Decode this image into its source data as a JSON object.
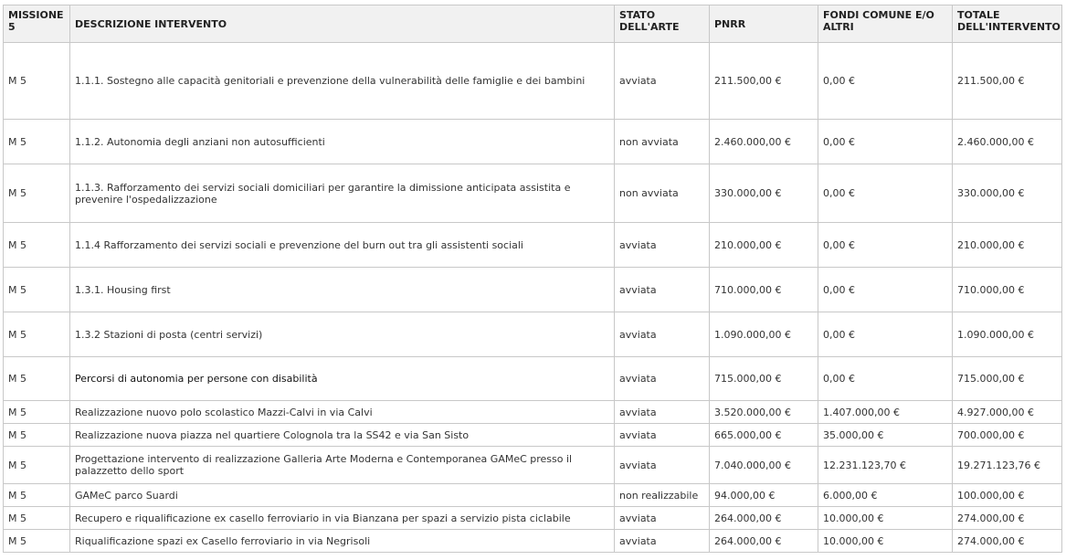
{
  "headers": {
    "missione": "MISSIONE 5",
    "descrizione": "DESCRIZIONE INTERVENTO",
    "stato": "STATO DELL'ARTE",
    "pnrr": "PNRR",
    "fondi": "FONDI COMUNE E/O ALTRI",
    "totale": "TOTALE DELL'INTERVENTO"
  },
  "rows": [
    {
      "missione": "M 5",
      "descrizione": "1.1.1. Sostegno alle capacità genitoriali e prevenzione della vulnerabilità delle famiglie e dei bambini",
      "stato": "avviata",
      "pnrr": "211.500,00 €",
      "fondi": "0,00 €",
      "totale": "211.500,00 €"
    },
    {
      "missione": "M 5",
      "descrizione": "1.1.2. Autonomia degli anziani non autosufficienti",
      "stato": "non avviata",
      "pnrr": "2.460.000,00 €",
      "fondi": "0,00 €",
      "totale": "2.460.000,00 €"
    },
    {
      "missione": "M 5",
      "descrizione": "1.1.3. Rafforzamento dei servizi sociali domiciliari per garantire la dimissione anticipata assistita e prevenire l'ospedalizzazione",
      "stato": "non avviata",
      "pnrr": "330.000,00 €",
      "fondi": "0,00 €",
      "totale": "330.000,00 €"
    },
    {
      "missione": "M 5",
      "descrizione": "1.1.4 Rafforzamento dei servizi sociali e prevenzione del burn out tra gli assistenti sociali",
      "stato": "avviata",
      "pnrr": "210.000,00 €",
      "fondi": "0,00 €",
      "totale": "210.000,00 €"
    },
    {
      "missione": "M 5",
      "descrizione": "1.3.1. Housing first",
      "stato": "avviata",
      "pnrr": "710.000,00 €",
      "fondi": "0,00 €",
      "totale": "710.000,00 €"
    },
    {
      "missione": "M 5",
      "descrizione": "1.3.2 Stazioni di posta (centri servizi)",
      "stato": "avviata",
      "pnrr": "1.090.000,00 €",
      "fondi": "0,00 €",
      "totale": "1.090.000,00 €"
    },
    {
      "missione": "M 5",
      "descrizione": "Percorsi di autonomia per persone con disabilità",
      "stato": "avviata",
      "pnrr": "715.000,00 €",
      "fondi": "0,00 €",
      "totale": "715.000,00 €"
    },
    {
      "missione": "M 5",
      "descrizione": "Realizzazione nuovo polo scolastico Mazzi-Calvi in via Calvi",
      "stato": "avviata",
      "pnrr": "3.520.000,00 €",
      "fondi": "1.407.000,00 €",
      "totale": "4.927.000,00 €"
    },
    {
      "missione": "M 5",
      "descrizione": "Realizzazione nuova piazza nel quartiere Colognola tra la SS42 e via San Sisto",
      "stato": "avviata",
      "pnrr": "665.000,00 €",
      "fondi": "35.000,00 €",
      "totale": "700.000,00 €"
    },
    {
      "missione": "M 5",
      "descrizione": "Progettazione intervento di realizzazione Galleria Arte Moderna e Contemporanea GAMeC presso il palazzetto dello sport",
      "stato": "avviata",
      "pnrr": "7.040.000,00 €",
      "fondi": "12.231.123,70 €",
      "totale": "19.271.123,76 €"
    },
    {
      "missione": "M 5",
      "descrizione": "GAMeC parco Suardi",
      "stato": "non realizzabile",
      "pnrr": "94.000,00 €",
      "fondi": "6.000,00 €",
      "totale": "100.000,00 €"
    },
    {
      "missione": "M 5",
      "descrizione": "Recupero e riqualificazione ex casello ferroviario in via Bianzana per spazi a servizio pista ciclabile",
      "stato": "avviata",
      "pnrr": "264.000,00 €",
      "fondi": "10.000,00 €",
      "totale": "274.000,00 €"
    },
    {
      "missione": "M 5",
      "descrizione": "Riqualificazione spazi ex Casello ferroviario in via Negrisoli",
      "stato": "avviata",
      "pnrr": "264.000,00 €",
      "fondi": "10.000,00 €",
      "totale": "274.000,00 €"
    }
  ]
}
